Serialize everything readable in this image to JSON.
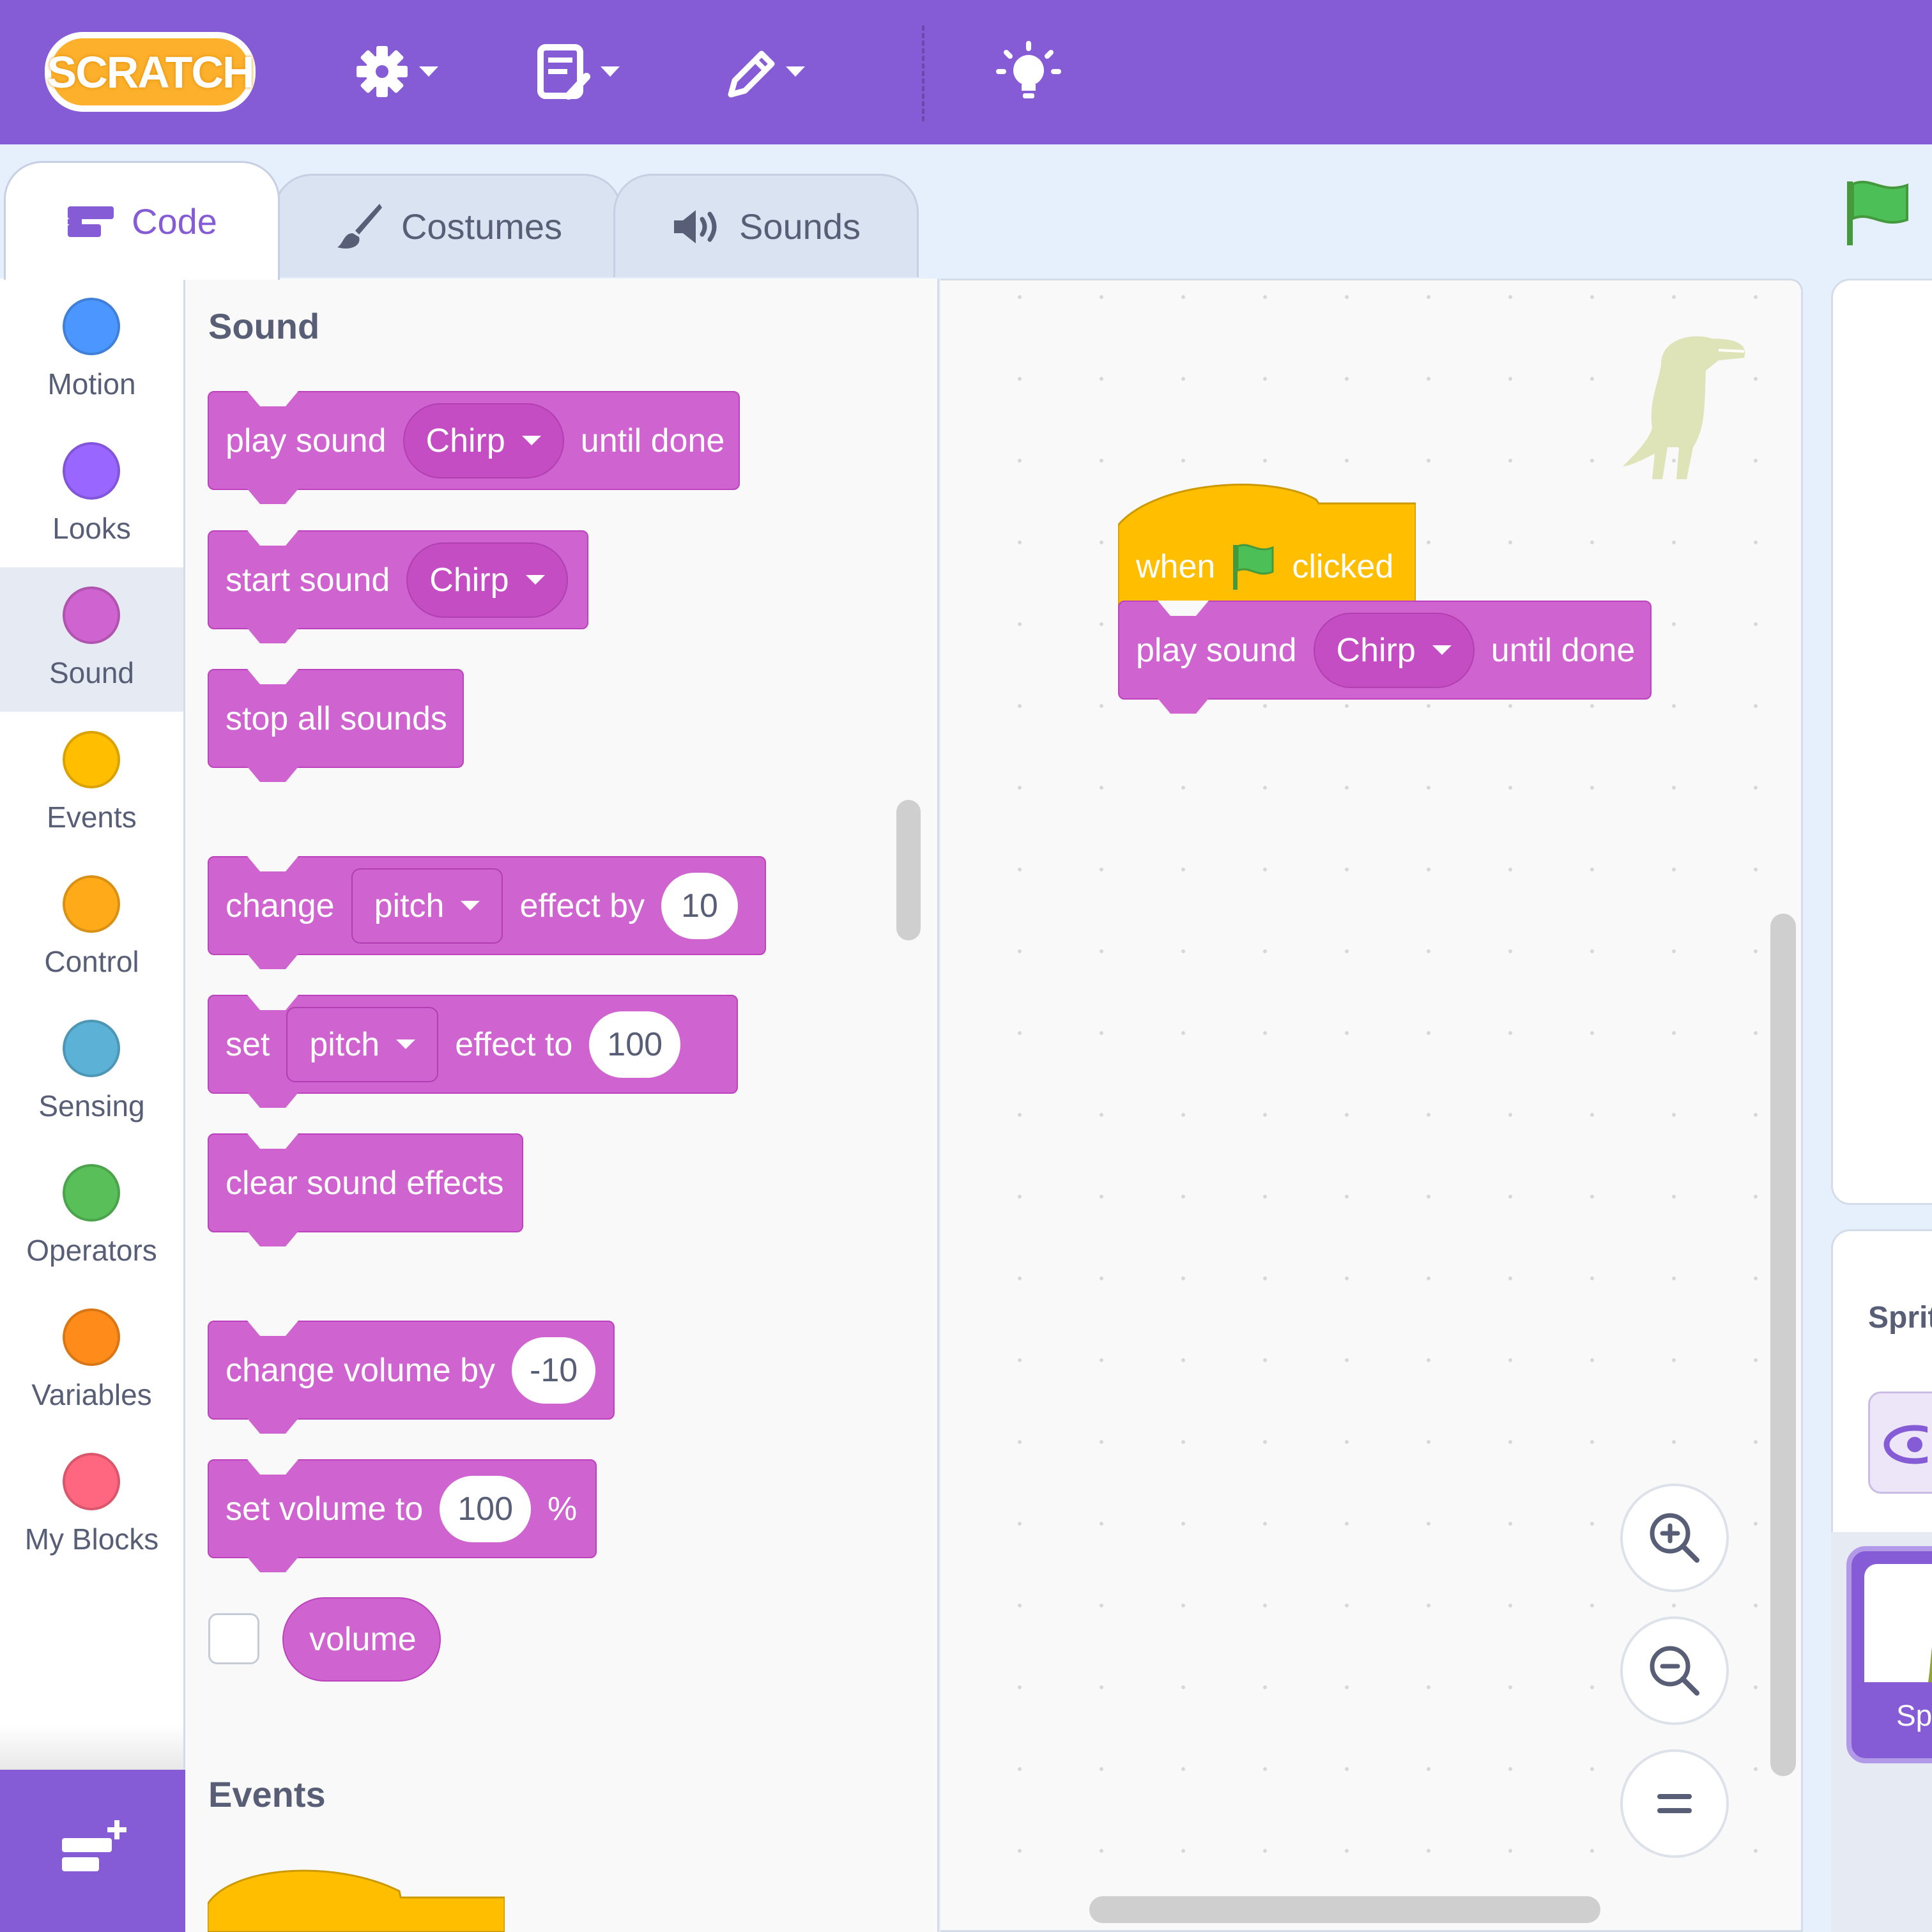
{
  "menubar": {
    "logo_text": "SCRATCH",
    "icons": [
      "gear-icon",
      "file-icon",
      "edit-pencil-icon",
      "tutorials-bulb-icon"
    ]
  },
  "tabs": [
    {
      "label": "Code",
      "icon": "code-blocks-icon",
      "active": true
    },
    {
      "label": "Costumes",
      "icon": "paintbrush-icon",
      "active": false
    },
    {
      "label": "Sounds",
      "icon": "speaker-icon",
      "active": false
    }
  ],
  "categories": [
    {
      "label": "Motion",
      "color": "#4c97ff"
    },
    {
      "label": "Looks",
      "color": "#9966ff"
    },
    {
      "label": "Sound",
      "color": "#cf63cf",
      "selected": true
    },
    {
      "label": "Events",
      "color": "#ffbf00"
    },
    {
      "label": "Control",
      "color": "#ffab19"
    },
    {
      "label": "Sensing",
      "color": "#5cb1d6"
    },
    {
      "label": "Operators",
      "color": "#59c059"
    },
    {
      "label": "Variables",
      "color": "#ff8c1a"
    },
    {
      "label": "My Blocks",
      "color": "#ff6680"
    }
  ],
  "palette": {
    "sections": {
      "sound": "Sound",
      "events": "Events"
    },
    "play_sound": {
      "text1": "play sound",
      "sound": "Chirp",
      "text2": "until done"
    },
    "start_sound": {
      "text1": "start sound",
      "sound": "Chirp"
    },
    "stop_all": {
      "text": "stop all sounds"
    },
    "change_effect": {
      "text1": "change",
      "effect": "pitch",
      "text2": "effect by",
      "value": "10"
    },
    "set_effect": {
      "text1": "set",
      "effect": "pitch",
      "text2": "effect to",
      "value": "100"
    },
    "clear_effects": {
      "text": "clear sound effects"
    },
    "change_volume": {
      "text1": "change volume by",
      "value": "-10"
    },
    "set_volume": {
      "text1": "set volume to",
      "value": "100",
      "unit": "%"
    },
    "volume_reporter": {
      "text": "volume"
    }
  },
  "script": {
    "hat": {
      "text1": "when",
      "text2": "clicked"
    },
    "play_sound": {
      "text1": "play sound",
      "sound": "Chirp",
      "text2": "until done"
    }
  },
  "sprite_pane": {
    "label": "Sprit",
    "thumb_name": "Sp"
  },
  "colors": {
    "menubar": "#855cd6",
    "sound_block": "#cf63cf",
    "events_block": "#ffbf00"
  }
}
